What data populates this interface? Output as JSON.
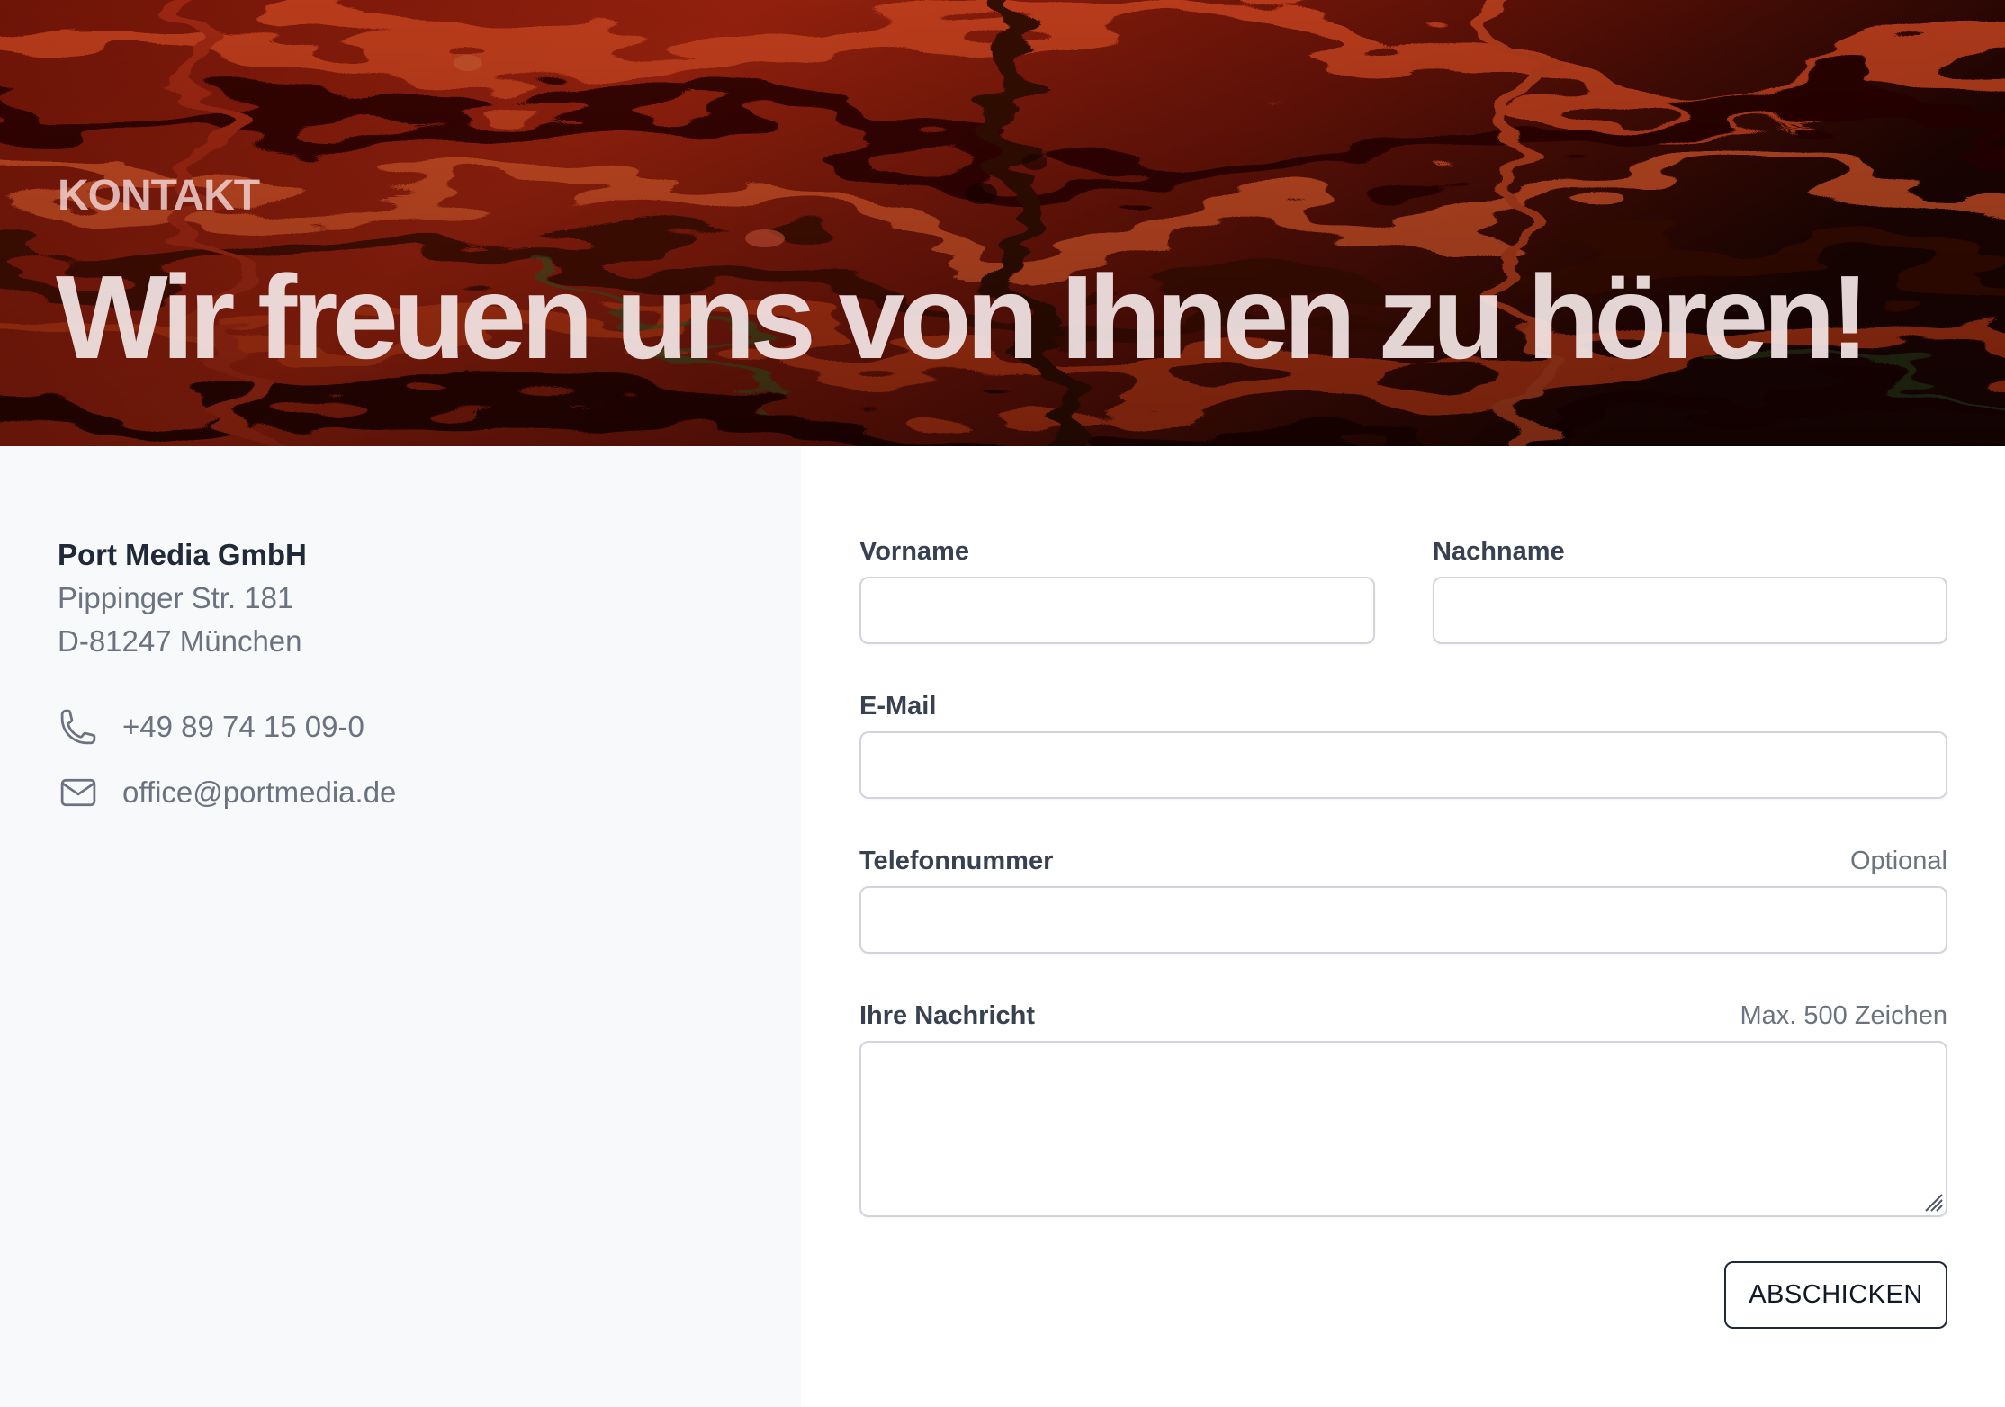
{
  "hero": {
    "eyebrow": "KONTAKT",
    "title": "Wir freuen uns von Ihnen zu hören!"
  },
  "company": {
    "name": "Port Media GmbH",
    "address_line_1": "Pippinger Str. 181",
    "address_line_2": "D-81247 München",
    "phone": "+49 89 74 15 09-0",
    "email": "office@portmedia.de",
    "phone_icon": "phone-icon",
    "email_icon": "envelope-icon"
  },
  "form": {
    "first_name_label": "Vorname",
    "first_name_value": "",
    "last_name_label": "Nachname",
    "last_name_value": "",
    "email_label": "E-Mail",
    "email_value": "",
    "phone_label": "Telefonnummer",
    "phone_hint": "Optional",
    "phone_value": "",
    "message_label": "Ihre Nachricht",
    "message_hint": "Max. 500 Zeichen",
    "message_value": "",
    "submit_label": "ABSCHICKEN"
  },
  "colors": {
    "hero_base": "#3a0a04",
    "hero_accent": "#c0311b",
    "panel_background": "#f8f9fb",
    "text_primary": "#1f2937",
    "text_muted": "#6b7280",
    "border": "#d1d5db"
  }
}
